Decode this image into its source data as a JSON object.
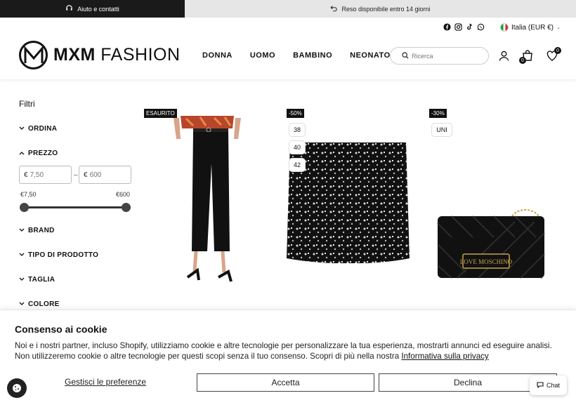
{
  "topbar": {
    "help_text": "Aiuto e contatti",
    "return_text": "Reso disponibile entro 14 giorni"
  },
  "header": {
    "logo_mark": "M",
    "logo_bold": "MXM",
    "logo_light": " FASHION",
    "locale": "Italia (EUR €)",
    "nav": [
      "DONNA",
      "UOMO",
      "BAMBINO",
      "NEONATO"
    ],
    "search_placeholder": "Ricerca",
    "cart_count": "0",
    "wishlist_count": "0"
  },
  "filters": {
    "title": "Filtri",
    "ordina": "ORDINA",
    "prezzo": "PREZZO",
    "min_placeholder": "7,50",
    "max_placeholder": "600",
    "currency": "€",
    "dash": "–",
    "range_min": "€7,50",
    "range_max": "€600",
    "brand": "BRAND",
    "tipo": "TIPO DI PRODOTTO",
    "taglia": "TAGLIA",
    "colore": "COLORE"
  },
  "products": [
    {
      "tag": "ESAURITO",
      "sizes": []
    },
    {
      "tag": "-50%",
      "sizes": [
        "38",
        "40",
        "42"
      ]
    },
    {
      "tag": "-30%",
      "sizes": [
        "UNI"
      ]
    }
  ],
  "cookie": {
    "title": "Consenso ai cookie",
    "body": "Noi e i nostri partner, incluso Shopify, utilizziamo cookie e altre tecnologie per personalizzare la tua esperienza, mostrarti annunci ed eseguire analisi. Non utilizzeremo cookie o altre tecnologie per questi scopi senza il tuo consenso. Scopri di più nella nostra ",
    "privacy_link": "Informativa sulla privacy",
    "manage": "Gestisci le preferenze",
    "accept": "Accetta",
    "decline": "Declina"
  },
  "chat_label": "Chat",
  "bag_label": "LOVE MOSCHINO"
}
